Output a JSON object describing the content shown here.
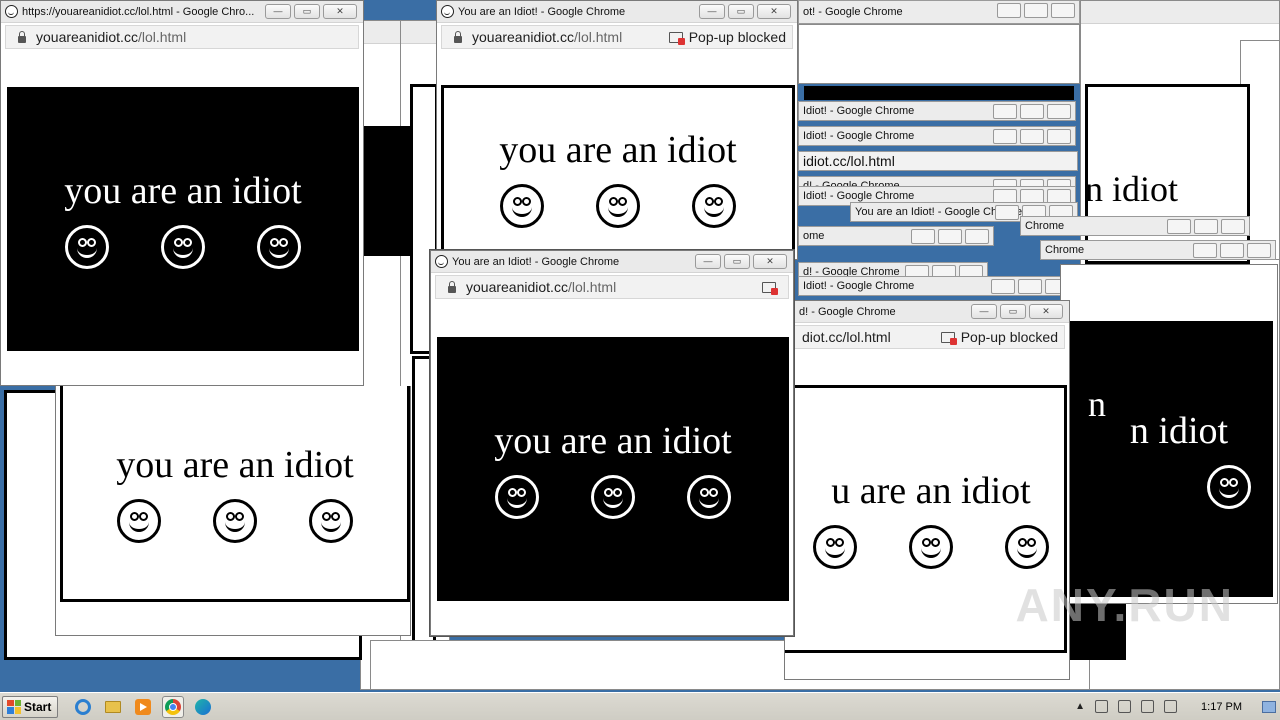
{
  "popup": {
    "title": "You are an Idiot! - Google Chrome",
    "title_truncated": "https://youareanidiot.cc/lol.html - Google Chro...",
    "title_fragment_1": "ot! - Google Chrome",
    "title_fragment_2": "Idiot! - Google Chrome",
    "title_fragment_3": "d! - Google Chrome",
    "title_fragment_4": "Chrome",
    "title_fragment_5": "ome",
    "domain": "youareanidiot.cc",
    "path": "/lol.html",
    "url_fragment": "idiot.cc/lol.html",
    "url_fragment_2": "diot.cc/lol.html",
    "popup_blocked": "Pop-up blocked",
    "message": "you are an idiot",
    "message_fragment_1": "n idiot",
    "message_fragment_2": "u are an idiot",
    "message_fragment_3": "n",
    "controls": {
      "minimize": "—",
      "maximize": "▭",
      "close": "✕"
    }
  },
  "watermark": "ANY.RUN",
  "taskbar": {
    "start_label": "Start",
    "clock": "1:17 PM",
    "pinned": [
      "internet-explorer-icon",
      "file-explorer-icon",
      "media-player-icon",
      "chrome-icon",
      "edge-icon"
    ]
  },
  "colors": {
    "desktop": "#3a6ea5",
    "taskbar": "#d4d0c8",
    "content_dark": "#000000",
    "content_light": "#ffffff"
  }
}
